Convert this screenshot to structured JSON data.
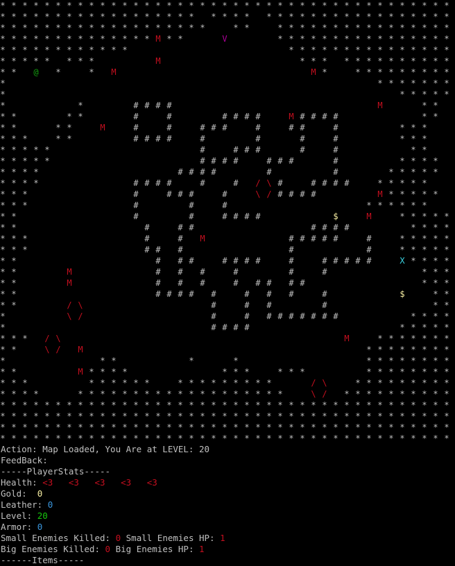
{
  "map": {
    "rows": [
      "* * * * * * * * * * * * * * * * * * * * * * * * * * * * * * * * * * * * * * * * *",
      "* * * * * * * * * * * * * * * * * *   * * * *   * * * * * * * * * * * * * * * * *",
      "* * * * * * * * * * * * * * * * * * *     * *     * * * * * * * * * * * * * * * *",
      "* * * * * * * * * * * * * * M * *       V         * * * * * * * * * * * * * * * *",
      "* * * * * * * * * * * *                             * * * * * * * * * * * * * * *",
      "* * * * *   * * *           M                         * * *   * * * * * * * * * *",
      "* *   @   *     *   M                                   M *     * * * * * * * * *",
      "*                                                                   * * * * * * *",
      "*                                                                       * * * * *",
      "*             *         # # # #                                     M       * *",
      "* *         * *         #     #         # # # #     M # # # #               * *",
      "* *       * *     M     #     #     # # #     #     # #     #           * * *",
      "* * *     * *           # # # #     #         #       #     #           * * *",
      "* * * * *                           #     # # #       #     #             * *",
      "* * * * *                           # # # #     # # #       #           * * * *",
      "* * * *                         # # # #         #           #         * * * * *",
      "* * * *                 # # # #     #     #   / \\ #     # # # #     * * * * *",
      "* * *                   #     # # #     #     \\ / # # # #           M * * * * *",
      "* * *                   #         #     #                         * * * * * *",
      "* *                     #         #     # # # #             $     M     * * * * *",
      "* *                       #     # #                     # # # #           * * * *",
      "* * *                     #     #   M               # # # # #     #     * * * * *",
      "* * *                     # #   #                   #             #     * * * * *",
      "* *                         #   # #     # # # #     #     # # # # #     X * * * *",
      "* *         M               #   #   #     #         #     #                 * * *",
      "* *         M               #   #   #     #   # #   # #                     * * *",
      "* *                         # # # #   #     #   #   #     #             $     * *",
      "* *         / \\                       #     #   #         #                   * *",
      "*           \\ /                       #     #   # # # # # # #             * * * *",
      "*                                     # # # #                           * * * * *",
      "* * *   / \\                                                   M     * * * * * * *",
      "* *     \\ /   M                                                   * * * * * * * *",
      "*                 * *             *       *                       * * * * * * * *",
      "* *           M * * * *                 * * *     * * *           * * * * * * * *",
      "* * *           * * * * * *     * * * * * * * * *       / \\     * * * * * * * * *",
      "* * * *       * * * * * * * * * * * * * * * * * * *     \\ /   * * * * * * * * * *",
      "* * * * * * * * * * * * * * * * * * * * * * * * * * * * * * * * * * * * * * * * *",
      "* * * * * * * * * * * * * * * * * * * * * * * * * * * * * * * * * * * * * * * * *",
      "* * * * * * * * * * * * * * * * * * * * * * * * * * * * * * * * * * * * * * * * *",
      "* * * * * * * * * * * * * * * * * * * * * * * * * * * * * * * * * * * * * * * * *"
    ],
    "symbol_colors": {
      "*": "#c0c0c0",
      "#": "#c0c0c0",
      "@": "#13a10e",
      "M": "#c50f1f",
      "V": "#b4009e",
      "X": "#3ad2e0",
      "$": "#f9f1a5",
      "/": "#c50f1f",
      "\\": "#c50f1f"
    }
  },
  "hud": {
    "action_label": "Action:",
    "action_text": "Map Loaded, You Are at LEVEL: 20",
    "feedback_label": "FeedBack:",
    "stats_header": "-----PlayerStats-----",
    "health_label": "Health:",
    "health_hearts": "<3   <3   <3   <3   <3",
    "gold_label": "Gold:",
    "gold_value": "0",
    "leather_label": "Leather:",
    "leather_value": "0",
    "level_label": "Level:",
    "level_value": "20",
    "armor_label": "Armor:",
    "armor_value": "0",
    "small_killed_label": "Small Enemies Killed:",
    "small_killed_value": "0",
    "small_hp_label": "Small Enemies HP:",
    "small_hp_value": "1",
    "big_killed_label": "Big Enemies Killed:",
    "big_killed_value": "0",
    "big_hp_label": "Big Enemies HP:",
    "big_hp_value": "1",
    "items_header": "------Items-----",
    "colors": {
      "text": "#c0c0c0",
      "red": "#c50f1f",
      "gold": "#f9f1a5",
      "leather": "#3a96dd",
      "level": "#16c60c",
      "armor": "#3a96dd"
    }
  }
}
